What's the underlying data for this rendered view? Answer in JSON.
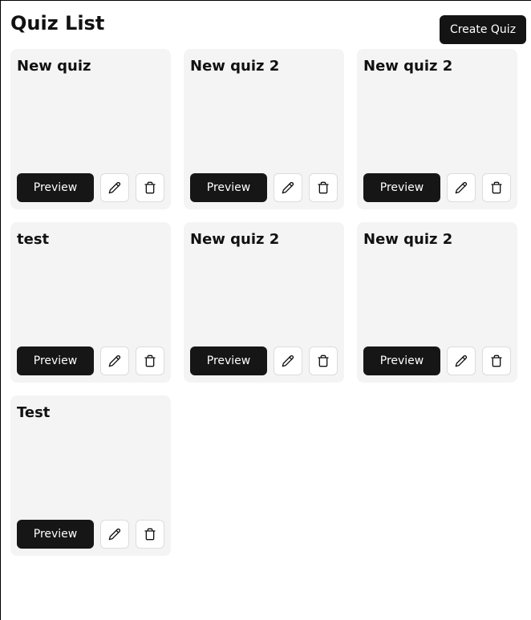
{
  "header": {
    "title": "Quiz List",
    "create_label": "Create Quiz"
  },
  "colors": {
    "primary_button": "#161616",
    "card_background": "#f4f4f4",
    "page_background": "#ffffff"
  },
  "quizzes": [
    {
      "title": "New quiz",
      "preview_label": "Preview",
      "edit_icon": "pencil-icon",
      "delete_icon": "trash-icon"
    },
    {
      "title": "New quiz 2",
      "preview_label": "Preview",
      "edit_icon": "pencil-icon",
      "delete_icon": "trash-icon"
    },
    {
      "title": "New quiz 2",
      "preview_label": "Preview",
      "edit_icon": "pencil-icon",
      "delete_icon": "trash-icon"
    },
    {
      "title": "test",
      "preview_label": "Preview",
      "edit_icon": "pencil-icon",
      "delete_icon": "trash-icon"
    },
    {
      "title": "New quiz 2",
      "preview_label": "Preview",
      "edit_icon": "pencil-icon",
      "delete_icon": "trash-icon"
    },
    {
      "title": "New quiz 2",
      "preview_label": "Preview",
      "edit_icon": "pencil-icon",
      "delete_icon": "trash-icon"
    },
    {
      "title": "Test",
      "preview_label": "Preview",
      "edit_icon": "pencil-icon",
      "delete_icon": "trash-icon"
    }
  ]
}
